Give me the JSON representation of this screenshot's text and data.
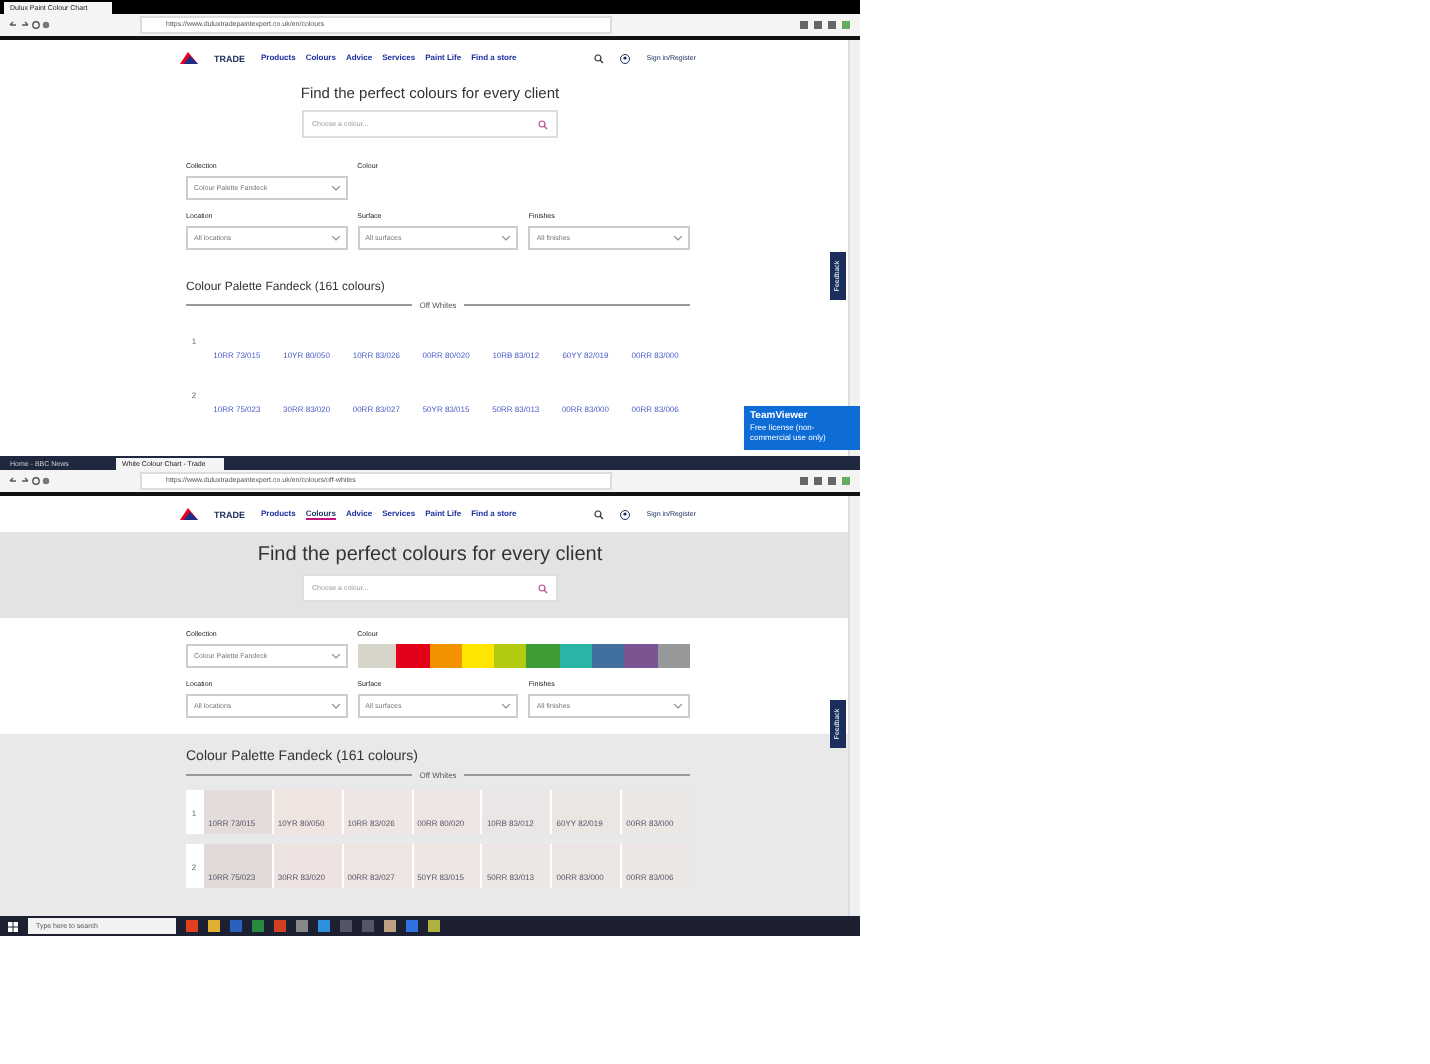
{
  "top_window": {
    "tabs": [
      {
        "label": "Dulux Paint Colour Chart",
        "selected": true
      }
    ],
    "url": "https://www.duluxtradepaintexpert.co.uk/en/colours",
    "brand": "TRADE",
    "nav": [
      {
        "label": "Products",
        "selected": false
      },
      {
        "label": "Colours",
        "selected": false
      },
      {
        "label": "Advice",
        "selected": false
      },
      {
        "label": "Services",
        "selected": false
      },
      {
        "label": "Paint Life",
        "selected": false
      },
      {
        "label": "Find a store",
        "selected": false
      }
    ],
    "account": "Sign in/Register",
    "heading": "Find the perfect colours for every client",
    "search": {
      "placeholder": "Choose a colour..."
    },
    "filters": [
      {
        "label": "Collection",
        "value": "Colour Palette Fandeck"
      },
      {
        "label": "Colour"
      },
      {
        "label": "Location",
        "value": "All locations"
      },
      {
        "label": "Surface",
        "value": "All surfaces"
      },
      {
        "label": "Finishes",
        "value": "All finishes"
      }
    ],
    "section_title": "Colour Palette Fandeck (161 colours)",
    "group_label": "Off Whites",
    "rows": [
      {
        "number": "1",
        "tiles": [
          {
            "code": "10RR 73/015"
          },
          {
            "code": "10YR 80/050"
          },
          {
            "code": "10RR 83/026"
          },
          {
            "code": "00RR 80/020"
          },
          {
            "code": "10RB 83/012"
          },
          {
            "code": "60YY 82/019"
          },
          {
            "code": "00RR 83/000"
          }
        ]
      },
      {
        "number": "2",
        "tiles": [
          {
            "code": "10RR 75/023"
          },
          {
            "code": "30RR 83/020"
          },
          {
            "code": "00RR 83/027"
          },
          {
            "code": "50YR 83/015"
          },
          {
            "code": "50RR 83/013"
          },
          {
            "code": "00RR 83/000"
          },
          {
            "code": "00RR 83/006"
          }
        ]
      }
    ],
    "feedback": "Feedback"
  },
  "teamviewer": {
    "title": "TeamViewer",
    "message": "Free license (non-commercial use only)"
  },
  "bottom_window": {
    "tabs": [
      {
        "label": "Home - BBC News",
        "selected": false
      },
      {
        "label": "White Colour Chart - Trade",
        "selected": true
      }
    ],
    "url": "https://www.duluxtradepaintexpert.co.uk/en/colours/off-whites",
    "brand": "TRADE",
    "nav": [
      {
        "label": "Products",
        "selected": false
      },
      {
        "label": "Colours",
        "selected": true
      },
      {
        "label": "Advice",
        "selected": false
      },
      {
        "label": "Services",
        "selected": false
      },
      {
        "label": "Paint Life",
        "selected": false
      },
      {
        "label": "Find a store",
        "selected": false
      }
    ],
    "account": "Sign in/Register",
    "heading": "Find the perfect colours for every client",
    "search": {
      "placeholder": "Choose a colour..."
    },
    "filters": [
      {
        "label": "Collection",
        "value": "Colour Palette Fandeck"
      },
      {
        "label": "Location",
        "value": "All locations"
      },
      {
        "label": "Surface",
        "value": "All surfaces"
      },
      {
        "label": "Finishes",
        "value": "All finishes"
      }
    ],
    "colour_label": "Colour",
    "swatches": [
      {
        "color": "#d6d4c8",
        "selected": true
      },
      {
        "color": "#e2001a",
        "selected": false
      },
      {
        "color": "#f39200",
        "selected": false
      },
      {
        "color": "#ffe500",
        "selected": false
      },
      {
        "color": "#b2cb10",
        "selected": false
      },
      {
        "color": "#3e9c35",
        "selected": false
      },
      {
        "color": "#2bb3a6",
        "selected": false
      },
      {
        "color": "#42709e",
        "selected": false
      },
      {
        "color": "#7a5592",
        "selected": false
      },
      {
        "color": "#979899",
        "selected": false
      }
    ],
    "section_title": "Colour Palette Fandeck (161 colours)",
    "group_label": "Off Whites",
    "rows": [
      {
        "number": "1",
        "tiles": [
          {
            "code": "10RR 73/015",
            "color": "#e3dcda"
          },
          {
            "code": "10YR 80/050",
            "color": "#efe4e0"
          },
          {
            "code": "10RR 83/026",
            "color": "#eee6e4"
          },
          {
            "code": "00RR 80/020",
            "color": "#ede5e3"
          },
          {
            "code": "10RB 83/012",
            "color": "#ebe6e5"
          },
          {
            "code": "60YY 82/019",
            "color": "#ece6e3"
          },
          {
            "code": "00RR 83/000",
            "color": "#ebe7e5"
          }
        ]
      },
      {
        "number": "2",
        "tiles": [
          {
            "code": "10RR 75/023",
            "color": "#e1d9d7"
          },
          {
            "code": "30RR 83/020",
            "color": "#efe3e1"
          },
          {
            "code": "00RR 83/027",
            "color": "#eee4e2"
          },
          {
            "code": "50YR 83/015",
            "color": "#ede6e3"
          },
          {
            "code": "50RR 83/013",
            "color": "#ece6e4"
          },
          {
            "code": "00RR 83/000",
            "color": "#ebe6e4"
          },
          {
            "code": "00RR 83/006",
            "color": "#ece7e4"
          }
        ]
      }
    ],
    "feedback": "Feedback"
  },
  "taskbar": {
    "search": {
      "placeholder": "Type here to search"
    }
  }
}
